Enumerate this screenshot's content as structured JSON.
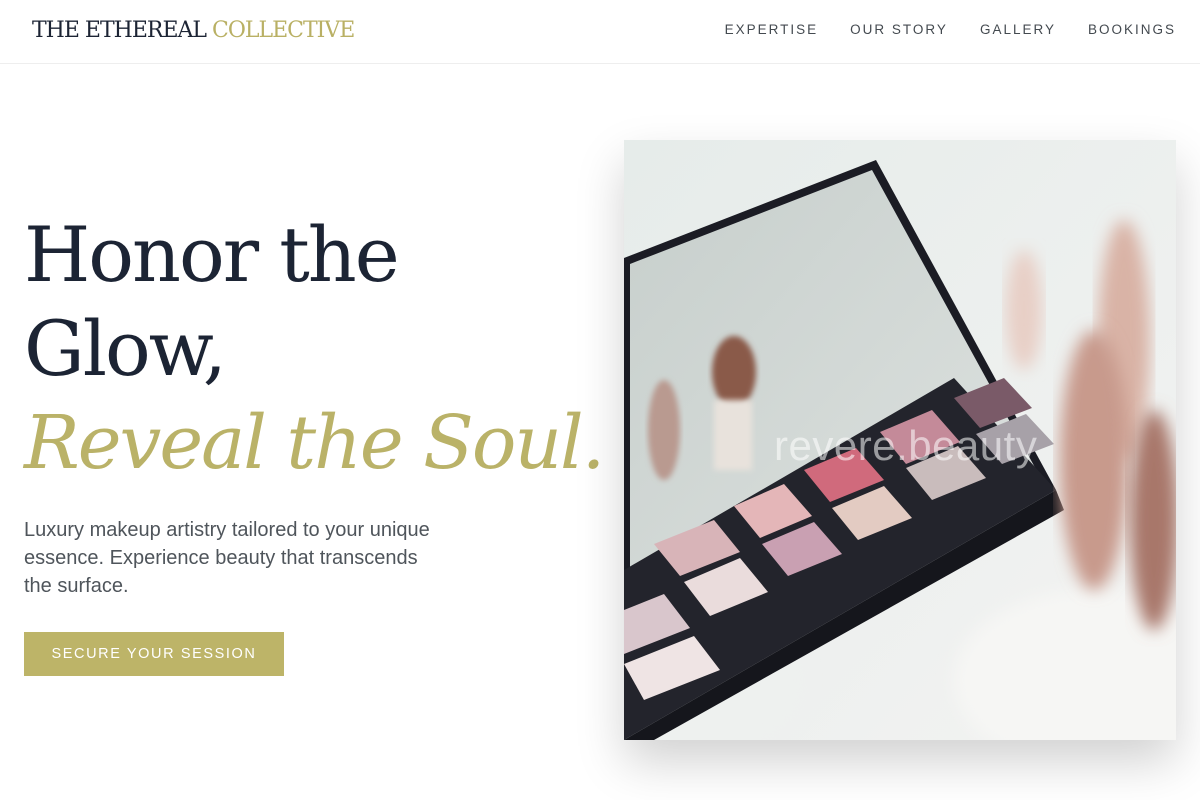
{
  "header": {
    "logo_part1": "THE ETHEREAL ",
    "logo_part2": "COLLECTIVE",
    "nav": [
      "EXPERTISE",
      "OUR STORY",
      "GALLERY",
      "BOOKINGS"
    ]
  },
  "hero": {
    "title_line1": "Honor the",
    "title_line2": "Glow,",
    "title_line3": "Reveal the Soul.",
    "subtext": "Luxury makeup artistry tailored to your unique essence. Experience beauty that transcends the surface.",
    "cta_label": "SECURE YOUR SESSION",
    "image_watermark": "revere.beauty"
  },
  "colors": {
    "navy": "#1c2434",
    "gold": "#bab268",
    "text_gray": "#4f555b"
  }
}
